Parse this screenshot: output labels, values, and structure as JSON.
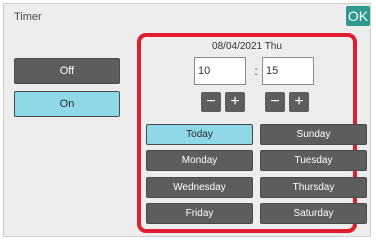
{
  "header": {
    "title": "Timer",
    "ok_label": "OK"
  },
  "toggle": {
    "off_label": "Off",
    "on_label": "On",
    "selected": "On"
  },
  "timer": {
    "date": "08/04/2021 Thu",
    "hour": "10",
    "separator": ":",
    "minute": "15",
    "minus_symbol": "−",
    "plus_symbol": "+"
  },
  "days": {
    "today": "Today",
    "sunday": "Sunday",
    "monday": "Monday",
    "tuesday": "Tuesday",
    "wednesday": "Wednesday",
    "thursday": "Thursday",
    "friday": "Friday",
    "saturday": "Saturday",
    "selected": "Today"
  },
  "colors": {
    "accent_red": "#e11d30",
    "selected_cyan": "#8fd8e8",
    "button_gray": "#5d5d5d",
    "ok_teal": "#2c9a8f"
  }
}
